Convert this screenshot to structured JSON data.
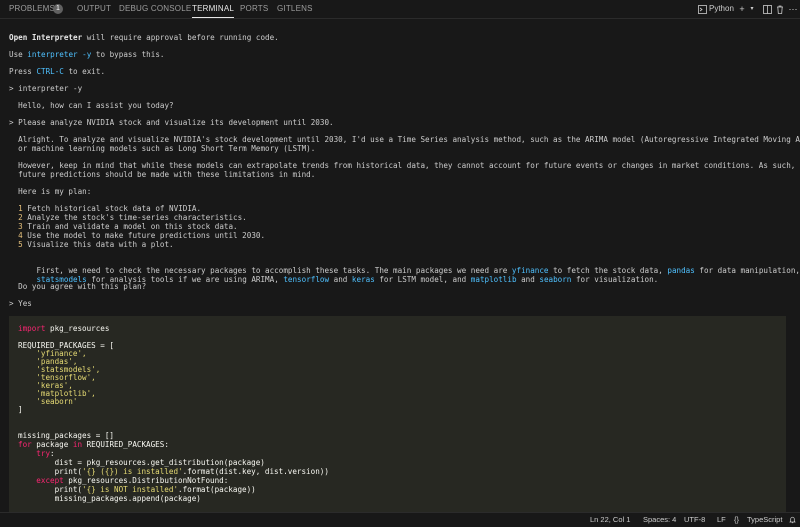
{
  "panel_tabs": {
    "problems": "PROBLEMS",
    "problems_count": "1",
    "output": "OUTPUT",
    "debug_console": "DEBUG CONSOLE",
    "terminal": "TERMINAL",
    "ports": "PORTS",
    "gitlens": "GITLENS"
  },
  "toolbar": {
    "shell_name": "Python",
    "shell_icon": "terminal-icon",
    "add_icon": "plus-icon",
    "dropdown_icon": "chevron-down-icon",
    "split_icon": "split-icon",
    "trash_icon": "trash-icon",
    "more_icon": "ellipsis-icon"
  },
  "terminal": {
    "line1_a": "Open Interpreter",
    "line1_b": " will require approval before running code.",
    "line2_a": "Use ",
    "line2_b": "interpreter -y",
    "line2_c": " to bypass this.",
    "line3_a": "Press ",
    "line3_b": "CTRL-C",
    "line3_c": " to exit.",
    "cmd": "> interpreter -y",
    "greeting": "  Hello, how can I assist you today?",
    "user_prompt": "> Please analyze NVIDIA stock and visualize its development until 2030.",
    "para1_l1": "  Alright. To analyze and visualize NVIDIA's stock development until 2030, I'd use a Time Series analysis method, such as the ARIMA model (Autoregressive Integrated Moving Average)",
    "para1_l2": "  or machine learning models such as Long Short Term Memory (LSTM).",
    "para2_l1": "  However, keep in mind that while these models can extrapolate trends from historical data, they cannot account for future events or changes in market conditions. As such, any",
    "para2_l2": "  future predictions should be made with these limitations in mind.",
    "plan_header": "  Here is my plan:",
    "plan": [
      {
        "num": "1",
        "text": " Fetch historical stock data of NVIDIA."
      },
      {
        "num": "2",
        "text": " Analyze the stock's time-series characteristics."
      },
      {
        "num": "3",
        "text": " Train and validate a model on this stock data."
      },
      {
        "num": "4",
        "text": " Use the model to make future predictions until 2030."
      },
      {
        "num": "5",
        "text": " Visualize this data with a plot."
      }
    ],
    "pkg_l1": [
      {
        "t": "  First, we need to check the necessary packages to accomplish these tasks. The main packages we need are ",
        "k": false
      },
      {
        "t": "yfinance",
        "k": true
      },
      {
        "t": " to fetch the stock data, ",
        "k": false
      },
      {
        "t": "pandas",
        "k": true
      },
      {
        "t": " for data manipulation,",
        "k": false
      }
    ],
    "pkg_l2": [
      {
        "t": "  ",
        "k": false
      },
      {
        "t": "statsmodels",
        "k": true
      },
      {
        "t": " for analysis tools if we are using ARIMA, ",
        "k": false
      },
      {
        "t": "tensorflow",
        "k": true
      },
      {
        "t": " and ",
        "k": false
      },
      {
        "t": "keras",
        "k": true
      },
      {
        "t": " for LSTM model, and ",
        "k": false
      },
      {
        "t": "matplotlib",
        "k": true
      },
      {
        "t": " and ",
        "k": false
      },
      {
        "t": "seaborn",
        "k": true
      },
      {
        "t": " for visualization.",
        "k": false
      }
    ],
    "agree": "  Do you agree with this plan?",
    "yes": "> Yes"
  },
  "code": {
    "import_kw": "import",
    "import_rest": " pkg_resources",
    "req_open": "REQUIRED_PACKAGES = [",
    "packages": [
      "'yfinance',",
      "'pandas',",
      "'statsmodels',",
      "'tensorflow',",
      "'keras',",
      "'matplotlib',",
      "'seaborn'"
    ],
    "req_close": "]",
    "missing": "missing_packages = []",
    "for_kw": "for",
    "for_mid": " package ",
    "in_kw": "in",
    "for_rest": " REQUIRED_PACKAGES:",
    "try_kw": "try",
    "try_rest": ":",
    "dist_line": "dist = pkg_resources.get_distribution(package)",
    "print1_a": "print(",
    "print1_str": "'{} ({}) is installed'",
    "print1_b": ".format(dist.key, dist.version))",
    "except_kw": "except",
    "except_rest": " pkg_resources.DistributionNotFound:",
    "print2_a": "print(",
    "print2_str": "'{} is NOT installed'",
    "print2_b": ".format(package))",
    "append_line": "missing_packages.append(package)"
  },
  "status_bar": {
    "position": "Ln 22, Col 1",
    "spaces": "Spaces: 4",
    "encoding": "UTF-8",
    "eol": "LF",
    "language": "TypeScript",
    "language_icon": "braces-icon",
    "bell_icon": "bell-icon"
  }
}
